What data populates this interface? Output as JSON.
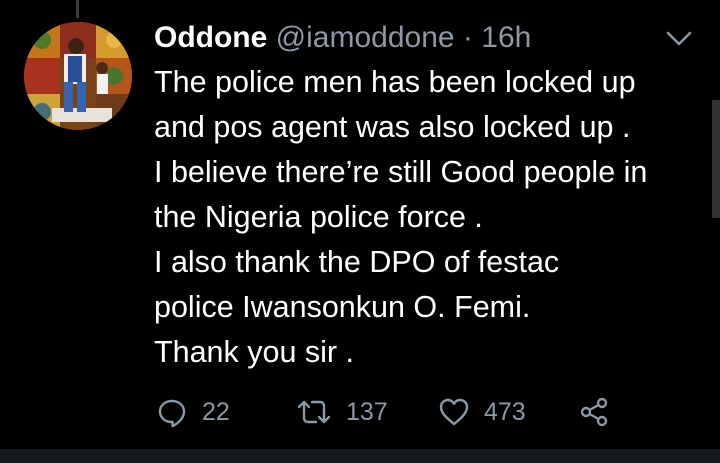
{
  "tweet": {
    "author_name": "Oddone",
    "handle": "@iamoddone",
    "separator": "·",
    "time": "16h",
    "lines": [
      "The police men has been locked up",
      "and pos agent was also locked up .",
      "I believe there’re still Good people in",
      "the Nigeria police force .",
      "I also thank the DPO of festac",
      "police Iwansonkun O. Femi.",
      "Thank you sir ."
    ]
  },
  "actions": {
    "reply_count": "22",
    "retweet_count": "137",
    "like_count": "473"
  },
  "icons": [
    "reply-icon",
    "retweet-icon",
    "like-icon",
    "share-icon",
    "chevron-down-icon"
  ],
  "colors": {
    "background": "#000000",
    "text": "#ffffff",
    "muted": "#8b98a5"
  }
}
